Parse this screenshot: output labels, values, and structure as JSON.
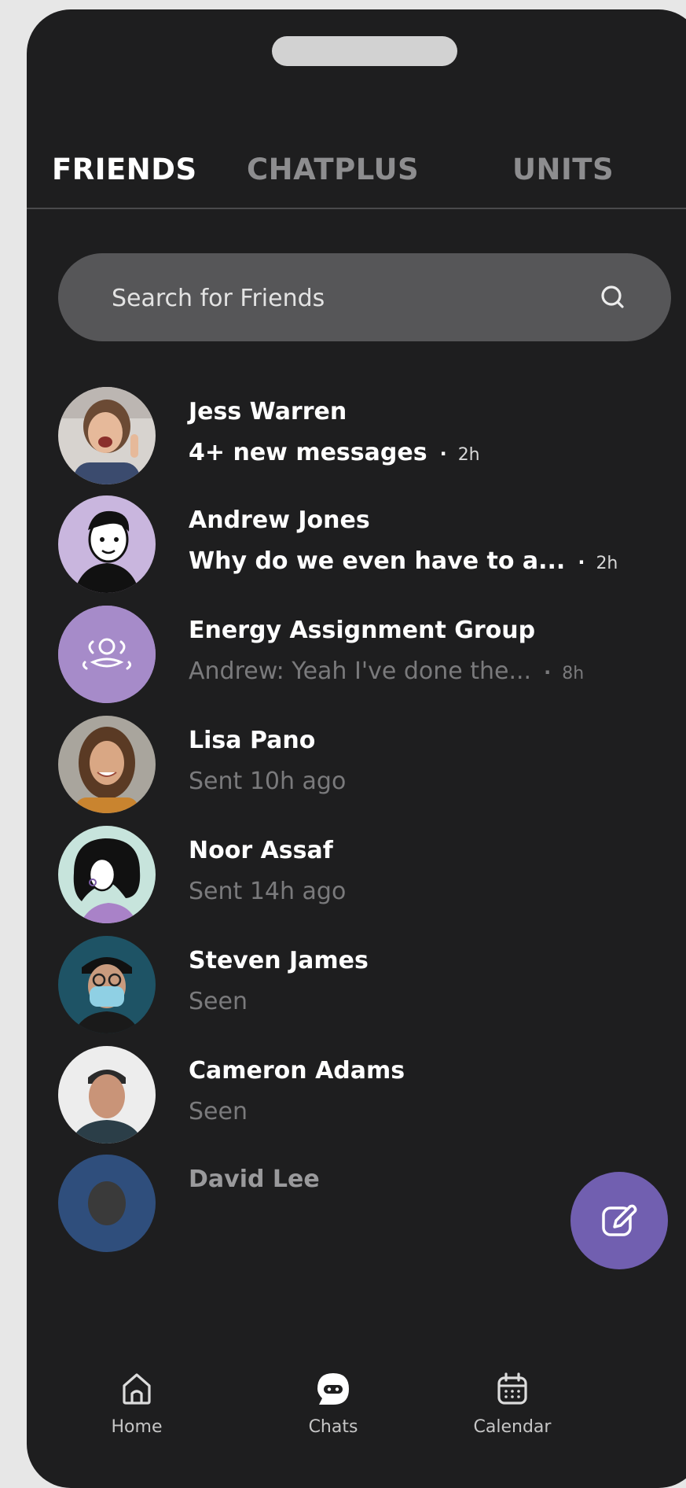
{
  "tabs": [
    {
      "label": "FRIENDS",
      "active": true
    },
    {
      "label": "CHATPLUS",
      "active": false
    },
    {
      "label": "UNITS",
      "active": false
    }
  ],
  "search": {
    "placeholder": "Search for Friends",
    "icon": "search-icon"
  },
  "chats": [
    {
      "name": "Jess Warren",
      "subtitle": "4+ new messages",
      "time": "2h",
      "unread": true,
      "avatar": "photo"
    },
    {
      "name": "Andrew Jones",
      "subtitle": "Why do we even have to a...",
      "time": "2h",
      "unread": true,
      "avatar": "illustration"
    },
    {
      "name": "Energy Assignment Group",
      "subtitle": "Andrew: Yeah I've done the...",
      "time": "8h",
      "unread": false,
      "avatar": "group-icon"
    },
    {
      "name": "Lisa Pano",
      "subtitle": "Sent 10h ago",
      "time": "",
      "unread": false,
      "avatar": "photo"
    },
    {
      "name": "Noor Assaf",
      "subtitle": "Sent 14h ago",
      "time": "",
      "unread": false,
      "avatar": "illustration"
    },
    {
      "name": "Steven James",
      "subtitle": "Seen",
      "time": "",
      "unread": false,
      "avatar": "photo"
    },
    {
      "name": "Cameron Adams",
      "subtitle": "Seen",
      "time": "",
      "unread": false,
      "avatar": "photo"
    },
    {
      "name": "David Lee",
      "subtitle": "",
      "time": "",
      "unread": false,
      "avatar": "photo"
    }
  ],
  "fab": {
    "icon": "compose-icon"
  },
  "nav": [
    {
      "label": "Home",
      "icon": "home-icon"
    },
    {
      "label": "Chats",
      "icon": "chat-icon",
      "active": true
    },
    {
      "label": "Calendar",
      "icon": "calendar-icon"
    }
  ],
  "colors": {
    "background": "#1e1e1f",
    "accent": "#715fb0",
    "avatar_lilac": "#c9b6de",
    "search_bg": "#565658"
  }
}
